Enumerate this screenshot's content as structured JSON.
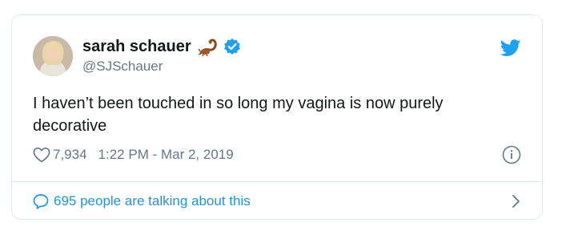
{
  "tweet": {
    "display_name": "sarah schauer",
    "handle": "@SJSchauer",
    "text": "I haven’t been touched in so long my vagina is now purely decorative",
    "likes": "7,934",
    "timestamp": "1:22 PM - Mar 2, 2019",
    "conversation": "695 people are talking about this"
  },
  "icons": {
    "name_emoji": "scorpion-icon",
    "verified": "verified-badge-icon",
    "brand": "twitter-bird-icon",
    "like": "heart-icon",
    "info": "info-icon",
    "reply": "speech-bubble-icon",
    "more": "chevron-right-icon"
  },
  "colors": {
    "brand_blue": "#1da1f2",
    "link_blue": "#1b95e0",
    "text_primary": "#14171a",
    "text_secondary": "#657786",
    "border": "#e1e8ed"
  }
}
